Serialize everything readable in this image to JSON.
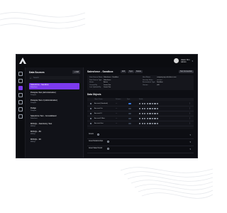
{
  "app": {
    "sidebar_title": "Data Sources",
    "add_label": "+ Add",
    "search_placeholder": "Search",
    "user": {
      "name": "Jason Kim",
      "role": "Admin"
    }
  },
  "data_sources": [
    {
      "name": "Salesforce - Sandbox",
      "sub": "Salesforce"
    },
    {
      "name": "Postgres Test (Administration)",
      "sub": "Postgres"
    },
    {
      "name": "Postgres Test 2 (Administration)",
      "sub": "Postgres"
    },
    {
      "name": "Dodge",
      "sub": "Postgres"
    },
    {
      "name": "Salesforce Test - Consolidated",
      "sub": "Salesforce"
    },
    {
      "name": "MSSQL - Field Entry Test",
      "sub": "MSSQL"
    },
    {
      "name": "MSSQL - 89",
      "sub": "MSSQL"
    },
    {
      "name": "MSSQL - 90",
      "sub": "MSSQL"
    }
  ],
  "main": {
    "title": "Salesforce - Sandbox",
    "pills": [
      "Edit",
      "Sync",
      "Delete"
    ],
    "primary_action": "Test Connection",
    "details_left": [
      {
        "k": "Data Source Name",
        "v": "Salesforce - Sandbox"
      },
      {
        "k": "Data Source Type",
        "v": "Salesforce"
      },
      {
        "k": "Status",
        "v": "Active"
      },
      {
        "k": "Created By",
        "v": "Jason Kim"
      },
      {
        "k": "Last Updated By",
        "v": "Jason Kim"
      }
    ],
    "details_right": [
      {
        "k": "Host Name",
        "v": "company.my.salesforce.com"
      },
      {
        "k": "Security Token",
        "v": "••••••••••"
      },
      {
        "k": "Environment Type",
        "v": "Sandbox"
      },
      {
        "k": "Version",
        "v": "v58"
      }
    ],
    "objects_title": "Data Objects",
    "table_headers": [
      "Object Name",
      "Schema",
      "Sync",
      "Fields",
      ""
    ],
    "table_rows": [
      {
        "name": "Account (Standard)",
        "schema": "—"
      },
      {
        "name": "Account Fin",
        "schema": "—"
      },
      {
        "name": "Account Ff",
        "schema": "—"
      },
      {
        "name": "Account Ff Aux",
        "schema": "—"
      },
      {
        "name": "Account Geo",
        "schema": "—"
      }
    ],
    "other_objects": [
      "Assets",
      "Asset Relationships",
      "Asset State Period"
    ]
  }
}
